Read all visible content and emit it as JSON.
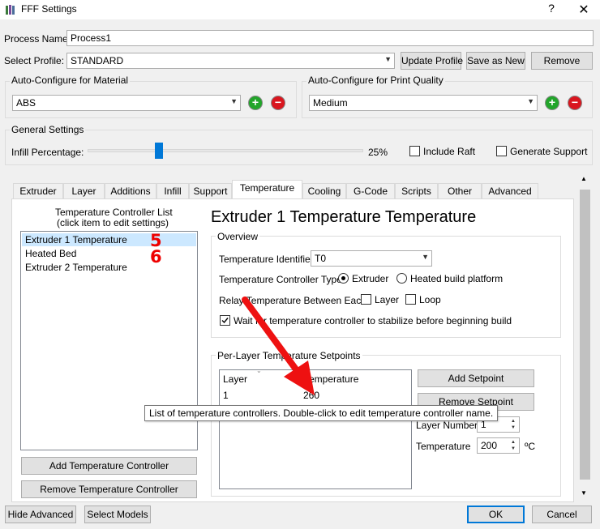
{
  "window": {
    "title": "FFF Settings",
    "help": "?",
    "close": "✕"
  },
  "process": {
    "label": "Process Name:",
    "value": "Process1"
  },
  "profile": {
    "label": "Select Profile:",
    "value": "STANDARD",
    "update": "Update Profile",
    "save_as": "Save as New",
    "remove": "Remove"
  },
  "material": {
    "title": "Auto-Configure for Material",
    "value": "ABS"
  },
  "quality": {
    "title": "Auto-Configure for Print Quality",
    "value": "Medium"
  },
  "general": {
    "title": "General Settings",
    "infill_label": "Infill Percentage:",
    "infill_value": "25%",
    "infill_fraction": 0.25,
    "raft": "Include Raft",
    "support": "Generate Support"
  },
  "tabs": [
    "Extruder",
    "Layer",
    "Additions",
    "Infill",
    "Support",
    "Temperature",
    "Cooling",
    "G-Code",
    "Scripts",
    "Other",
    "Advanced"
  ],
  "active_tab": "Temperature",
  "controller_list": {
    "title1": "Temperature Controller List",
    "title2": "(click item to edit settings)",
    "items": [
      "Extruder 1 Temperature",
      "Heated Bed",
      "Extruder 2 Temperature"
    ],
    "annot1": "5",
    "annot2": "6",
    "add": "Add Temperature Controller",
    "remove": "Remove Temperature Controller"
  },
  "detail": {
    "heading": "Extruder 1 Temperature Temperature",
    "overview": "Overview",
    "identifier_label": "Temperature Identifier",
    "identifier_value": "T0",
    "type_label": "Temperature Controller Type:",
    "type_extruder": "Extruder",
    "type_bed": "Heated build platform",
    "relay_label": "Relay Temperature Between Each:",
    "relay_layer": "Layer",
    "relay_loop": "Loop",
    "wait_label": "Wait for temperature controller to stabilize before beginning build"
  },
  "setpoints": {
    "title": "Per-Layer Temperature Setpoints",
    "col_layer": "Layer",
    "col_temp": "Temperature",
    "row_layer": "1",
    "row_temp": "260",
    "add": "Add Setpoint",
    "remove": "Remove Setpoint",
    "layer_label": "Layer Number",
    "layer_value": "1",
    "temp_label": "Temperature",
    "temp_value": "200",
    "unit": "ºC"
  },
  "tooltip": "List of temperature controllers.  Double-click to edit temperature controller name.",
  "footer": {
    "hide_adv": "Hide Advanced",
    "select_models": "Select Models",
    "ok": "OK",
    "cancel": "Cancel"
  },
  "colors": {
    "accent": "#0078d7",
    "annotation": "#e00000",
    "selection": "#cce8ff"
  }
}
